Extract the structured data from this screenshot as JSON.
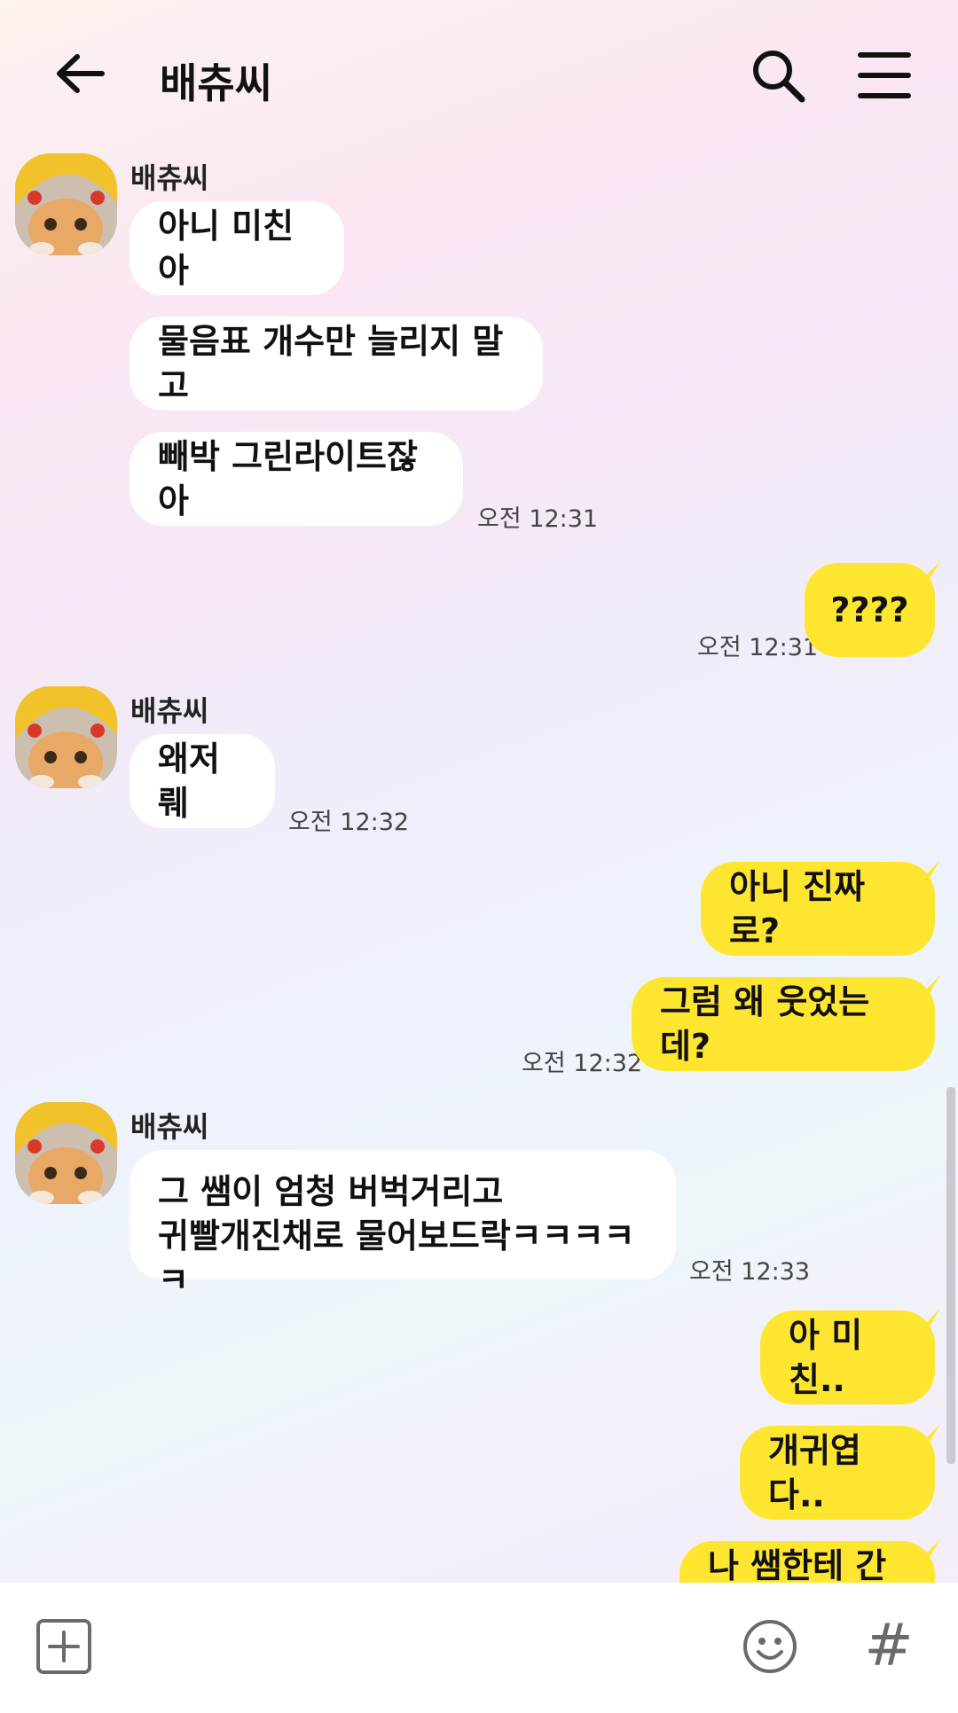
{
  "header": {
    "title": "배츄씨"
  },
  "messages": [
    {
      "dir": "in",
      "sender": "배츄씨",
      "text": "아니 미친아"
    },
    {
      "dir": "in",
      "text": "물음표 개수만 늘리지 말고"
    },
    {
      "dir": "in",
      "text": "빼박 그린라이트잖아",
      "time": "오전 12:31"
    },
    {
      "dir": "out",
      "text": "????",
      "time": "오전 12:31"
    },
    {
      "dir": "in",
      "sender": "배츄씨",
      "text": "왜저뤠",
      "time": "오전 12:32"
    },
    {
      "dir": "out",
      "text": "아니 진짜로?"
    },
    {
      "dir": "out",
      "text": "그럼 왜 웃었는데?",
      "time": "오전 12:32"
    },
    {
      "dir": "in",
      "sender": "배츄씨",
      "line1": "그 쌤이 엄청 버벅거리고",
      "line2": "귀빨개진채로 물어보드락ㅋㅋㅋㅋㅋ",
      "time": "오전 12:33"
    },
    {
      "dir": "out",
      "text": "아 미친.."
    },
    {
      "dir": "out",
      "text": "개귀엽다.."
    },
    {
      "dir": "out",
      "text": "나 쌤한테 간다"
    }
  ],
  "icons": {
    "back": "arrow-left-icon",
    "search": "search-icon",
    "menu": "hamburger-menu-icon",
    "add": "plus-square-icon",
    "emoji": "smiley-icon",
    "hashtag": "hash-icon",
    "avatar": "cat-in-pikachu-hat-avatar"
  },
  "input": {
    "hash_glyph": "#"
  },
  "colors": {
    "outgoing_bubble": "#fee630",
    "incoming_bubble": "#ffffff",
    "input_bar": "#ffffff"
  }
}
